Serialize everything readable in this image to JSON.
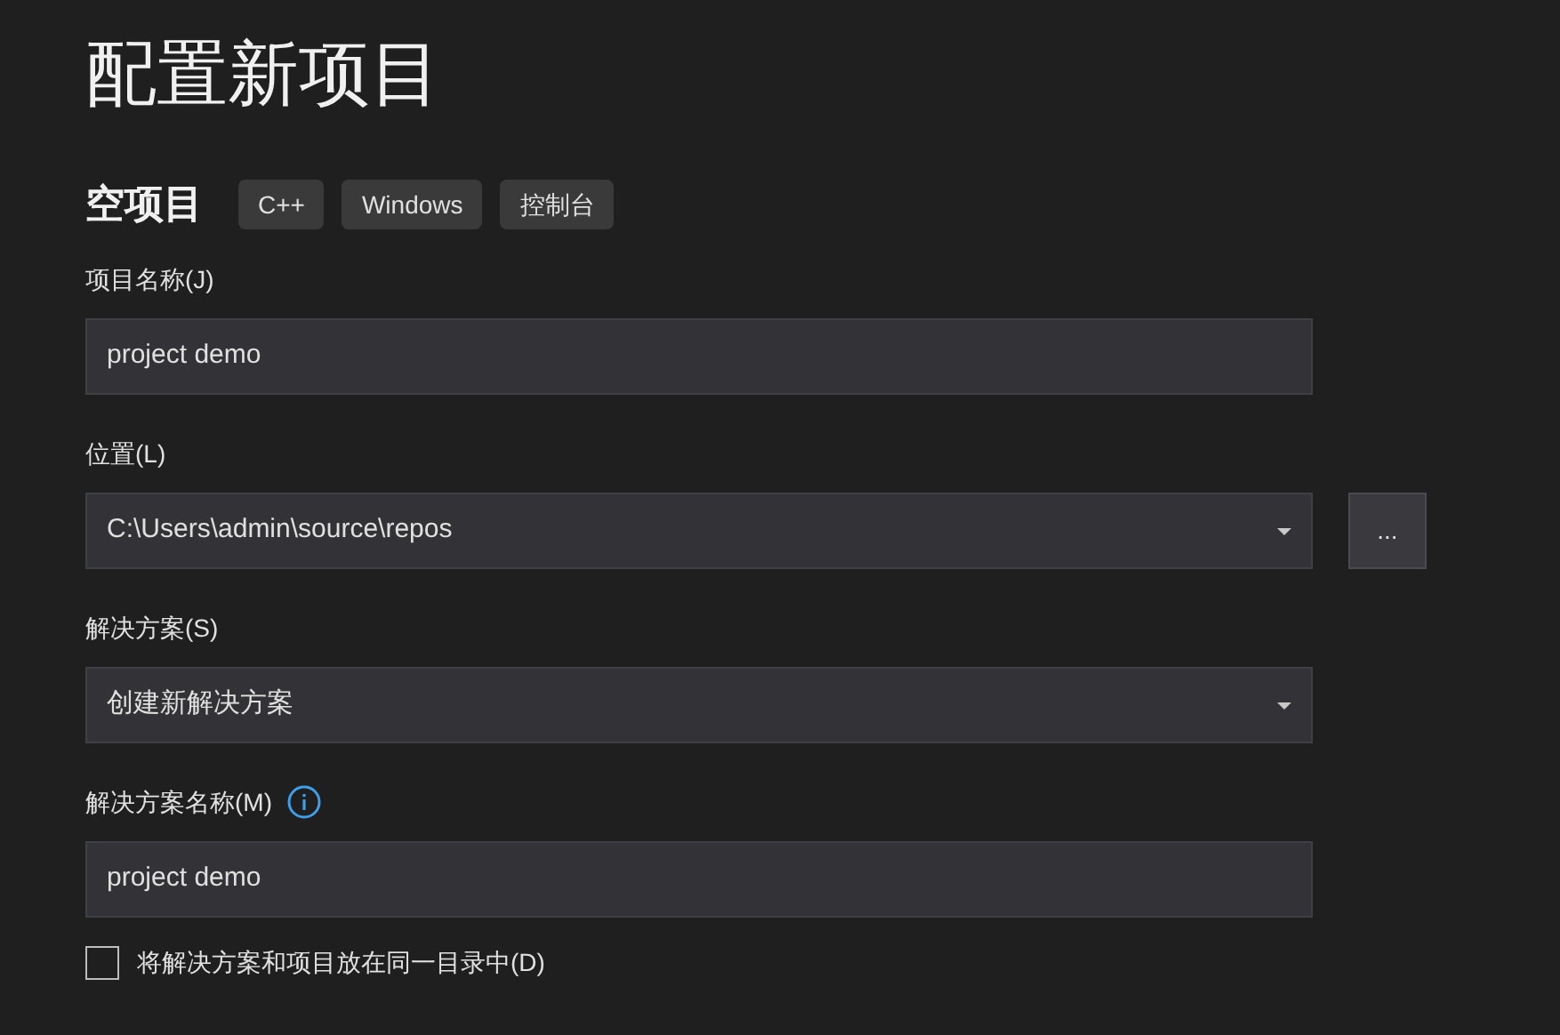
{
  "title": "配置新项目",
  "template": {
    "name": "空项目",
    "tags": [
      "C++",
      "Windows",
      "控制台"
    ]
  },
  "fields": [
    {
      "kind": "text",
      "label": "项目名称(J)",
      "value": "project demo"
    },
    {
      "kind": "dropdown",
      "label": "位置(L)",
      "value": "C:\\Users\\admin\\source\\repos",
      "browse_button": "..."
    },
    {
      "kind": "dropdown",
      "label": "解决方案(S)",
      "value": "创建新解决方案"
    },
    {
      "kind": "text",
      "label": "解决方案名称(M)",
      "value": "project demo",
      "info": true
    }
  ],
  "same_directory": {
    "label": "将解决方案和项目放在同一目录中(D)",
    "checked": false
  }
}
